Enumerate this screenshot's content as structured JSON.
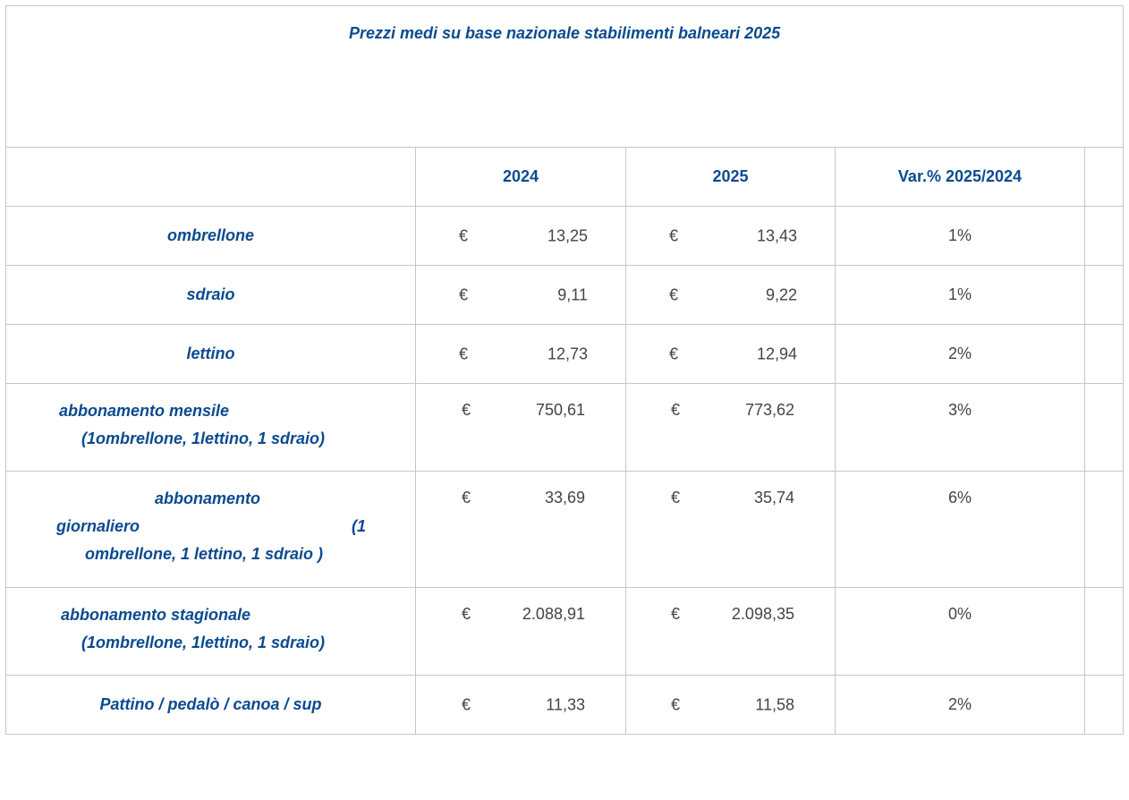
{
  "title": "Prezzi medi su base nazionale stabilimenti balneari 2025",
  "headers": {
    "col_2024": "2024",
    "col_2025": "2025",
    "col_var": "Var.% 2025/2024"
  },
  "currency_symbol": "€",
  "rows": [
    {
      "label": "ombrellone",
      "v2024": "13,25",
      "v2025": "13,43",
      "var": "1%"
    },
    {
      "label": "sdraio",
      "v2024": "9,11",
      "v2025": "9,22",
      "var": "1%"
    },
    {
      "label": "lettino",
      "v2024": "12,73",
      "v2025": "12,94",
      "var": "2%"
    },
    {
      "label_line1": "abbonamento mensile",
      "label_line2": "(1ombrellone, 1lettino, 1 sdraio)",
      "v2024": "750,61",
      "v2025": "773,62",
      "var": "3%"
    },
    {
      "label_line1": "abbonamento",
      "label_line2a": "giornaliero",
      "label_line2b": "(1",
      "label_line3": "ombrellone, 1 lettino, 1 sdraio )",
      "v2024": "33,69",
      "v2025": "35,74",
      "var": "6%"
    },
    {
      "label_line1": "abbonamento stagionale",
      "label_line2": "(1ombrellone, 1lettino, 1 sdraio)",
      "v2024": "2.088,91",
      "v2025": "2.098,35",
      "var": "0%"
    },
    {
      "label": "Pattino / pedalò  / canoa / sup",
      "v2024": "11,33",
      "v2025": "11,58",
      "var": "2%"
    }
  ]
}
